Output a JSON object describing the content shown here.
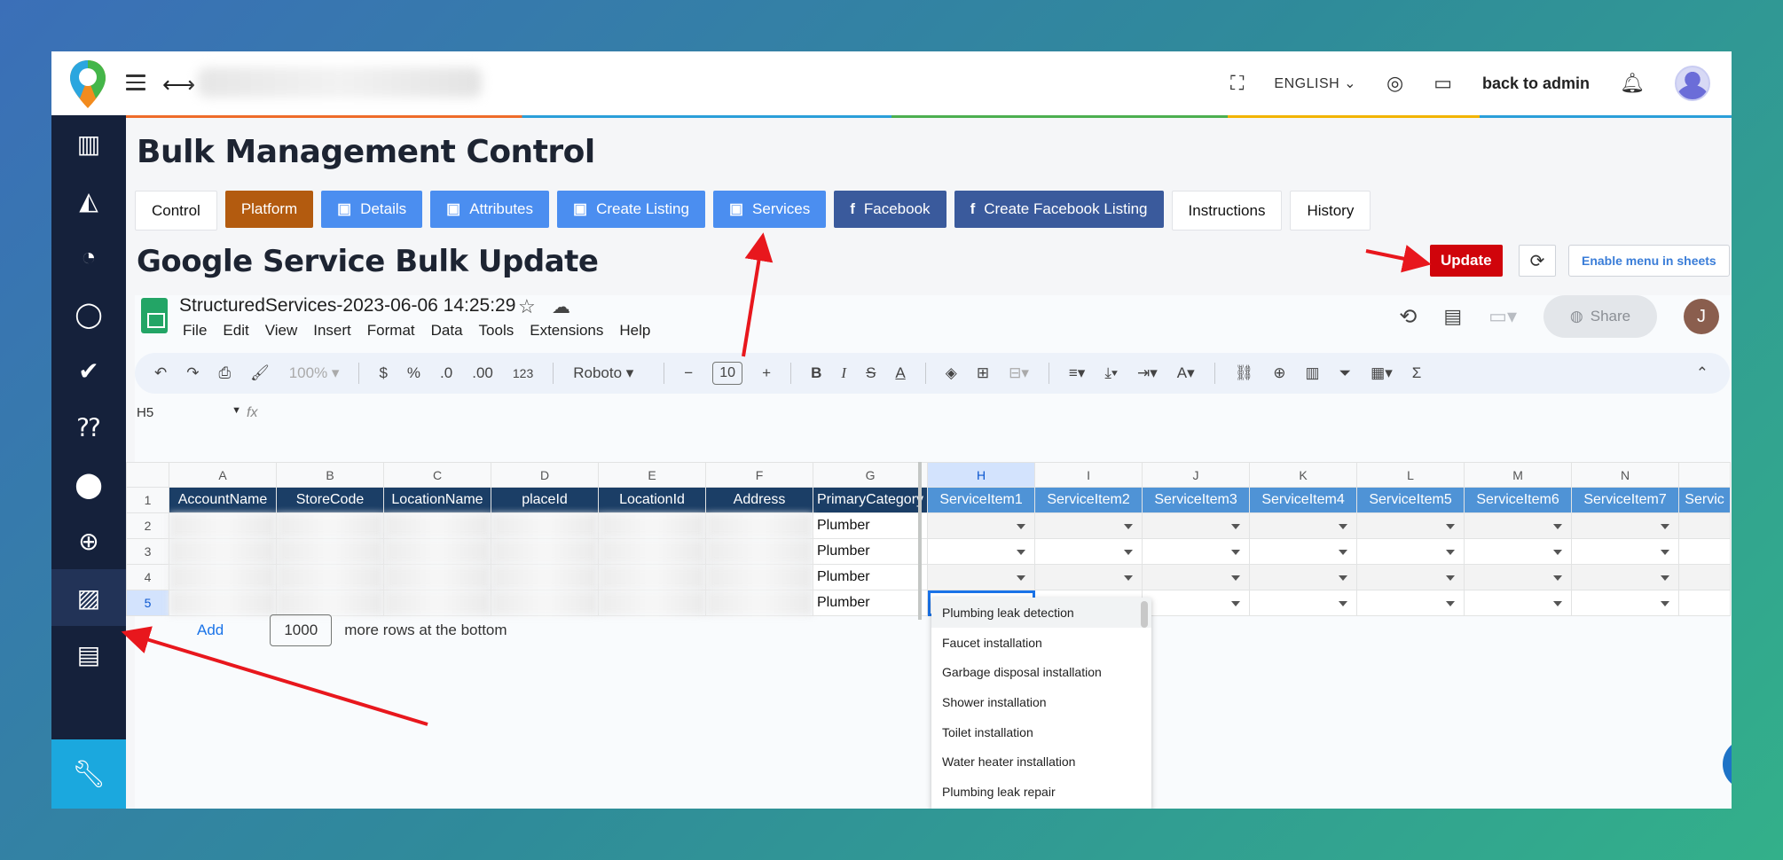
{
  "topbar": {
    "language": "ENGLISH",
    "back_admin": "back to admin"
  },
  "page": {
    "title": "Bulk Management Control",
    "section_title": "Google Service Bulk Update"
  },
  "tabs": [
    {
      "label": "Control",
      "style": "plain"
    },
    {
      "label": "Platform",
      "style": "orange"
    },
    {
      "label": "Details",
      "style": "blue"
    },
    {
      "label": "Attributes",
      "style": "blue"
    },
    {
      "label": "Create Listing",
      "style": "blue"
    },
    {
      "label": "Services",
      "style": "blue"
    },
    {
      "label": "Facebook",
      "style": "navy"
    },
    {
      "label": "Create Facebook Listing",
      "style": "navy"
    },
    {
      "label": "Instructions",
      "style": "plain"
    },
    {
      "label": "History",
      "style": "plain"
    }
  ],
  "actions": {
    "update": "Update",
    "enable_menu": "Enable menu in sheets"
  },
  "sheet": {
    "doc_title": "StructuredServices-2023-06-06 14:25:29",
    "menus": [
      "File",
      "Edit",
      "View",
      "Insert",
      "Format",
      "Data",
      "Tools",
      "Extensions",
      "Help"
    ],
    "share": "Share",
    "user_initial": "J",
    "zoom": "100%",
    "font": "Roboto",
    "font_size": "10",
    "name_box": "H5",
    "fx": "fx",
    "column_letters": [
      "A",
      "B",
      "C",
      "D",
      "E",
      "F",
      "G",
      "H",
      "I",
      "J",
      "K",
      "L",
      "M",
      "N",
      ""
    ],
    "headers": [
      "AccountName",
      "StoreCode",
      "LocationName",
      "placeId",
      "LocationId",
      "Address",
      "PrimaryCategory",
      "ServiceItem1",
      "ServiceItem2",
      "ServiceItem3",
      "ServiceItem4",
      "ServiceItem5",
      "ServiceItem6",
      "ServiceItem7",
      "Servic"
    ],
    "rows": [
      {
        "num": "2",
        "category": "Plumber"
      },
      {
        "num": "3",
        "category": "Plumber"
      },
      {
        "num": "4",
        "category": "Plumber"
      },
      {
        "num": "5",
        "category": "Plumber"
      }
    ],
    "add_label": "Add",
    "add_count": "1000",
    "add_suffix": "more rows at the bottom",
    "dropdown_options": [
      "Plumbing leak detection",
      "Faucet installation",
      "Garbage disposal installation",
      "Shower installation",
      "Toilet installation",
      "Water heater installation",
      "Plumbing leak repair"
    ]
  },
  "colors": {
    "sidebar": "#15213b",
    "update": "#d0040b",
    "tab_blue": "#4b8ef0",
    "tab_navy": "#3a5a9c",
    "tab_orange": "#b35b0f",
    "header_dark": "#1b3e66",
    "header_light": "#4f93d6",
    "arrow": "#e8171d"
  }
}
